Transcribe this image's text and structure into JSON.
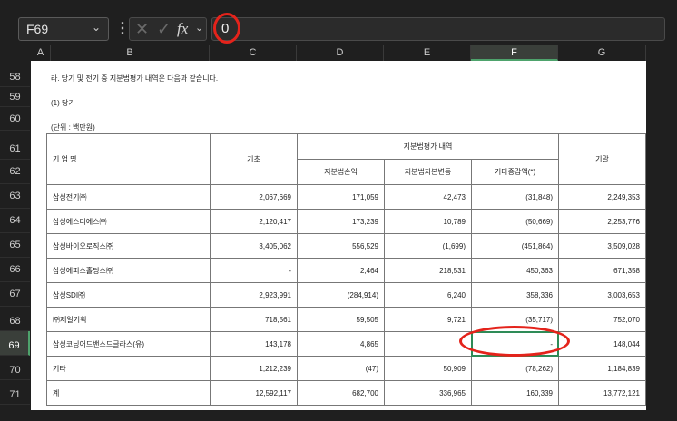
{
  "formula_bar": {
    "name_box": "F69",
    "cancel_icon": "close-icon",
    "enter_icon": "check-icon",
    "fx_label": "fx",
    "value": "0"
  },
  "columns": [
    "A",
    "B",
    "C",
    "D",
    "E",
    "F",
    "G"
  ],
  "rows": [
    "58",
    "59",
    "60",
    "61",
    "62",
    "63",
    "64",
    "65",
    "66",
    "67",
    "68",
    "69",
    "70",
    "71"
  ],
  "selected_cell": {
    "column": "F",
    "row": "69"
  },
  "notes": {
    "heading": "라. 당기 및 전기 중 지분법평가 내역은 다음과 같습니다.",
    "period": "(1) 당기",
    "unit": "(단위 : 백만원)"
  },
  "table": {
    "headers": {
      "company": "기 업 명",
      "opening": "기초",
      "group": "지분법평가 내역",
      "profit": "지분법손익",
      "capital": "지분법자본변동",
      "other": "기타증감액(*)",
      "closing": "기말"
    },
    "rows": [
      {
        "company": "삼성전기㈜",
        "opening": "2,067,669",
        "profit": "171,059",
        "capital": "42,473",
        "other": "(31,848)",
        "closing": "2,249,353"
      },
      {
        "company": "삼성에스디에스㈜",
        "opening": "2,120,417",
        "profit": "173,239",
        "capital": "10,789",
        "other": "(50,669)",
        "closing": "2,253,776"
      },
      {
        "company": "삼성바이오로직스㈜",
        "opening": "3,405,062",
        "profit": "556,529",
        "capital": "(1,699)",
        "other": "(451,864)",
        "closing": "3,509,028"
      },
      {
        "company": "삼성에피스홀딩스㈜",
        "opening": "-",
        "profit": "2,464",
        "capital": "218,531",
        "other": "450,363",
        "closing": "671,358"
      },
      {
        "company": "삼성SDI㈜",
        "opening": "2,923,991",
        "profit": "(284,914)",
        "capital": "6,240",
        "other": "358,336",
        "closing": "3,003,653"
      },
      {
        "company": "㈜제일기획",
        "opening": "718,561",
        "profit": "59,505",
        "capital": "9,721",
        "other": "(35,717)",
        "closing": "752,070"
      },
      {
        "company": "삼성코닝어드밴스드글라스(유)",
        "opening": "143,178",
        "profit": "4,865",
        "capital": "",
        "other": "-",
        "closing": "148,044"
      },
      {
        "company": "기타",
        "opening": "1,212,239",
        "profit": "(47)",
        "capital": "50,909",
        "other": "(78,262)",
        "closing": "1,184,839"
      },
      {
        "company": "계",
        "opening": "12,592,117",
        "profit": "682,700",
        "capital": "336,965",
        "other": "160,339",
        "closing": "13,772,121"
      }
    ]
  }
}
